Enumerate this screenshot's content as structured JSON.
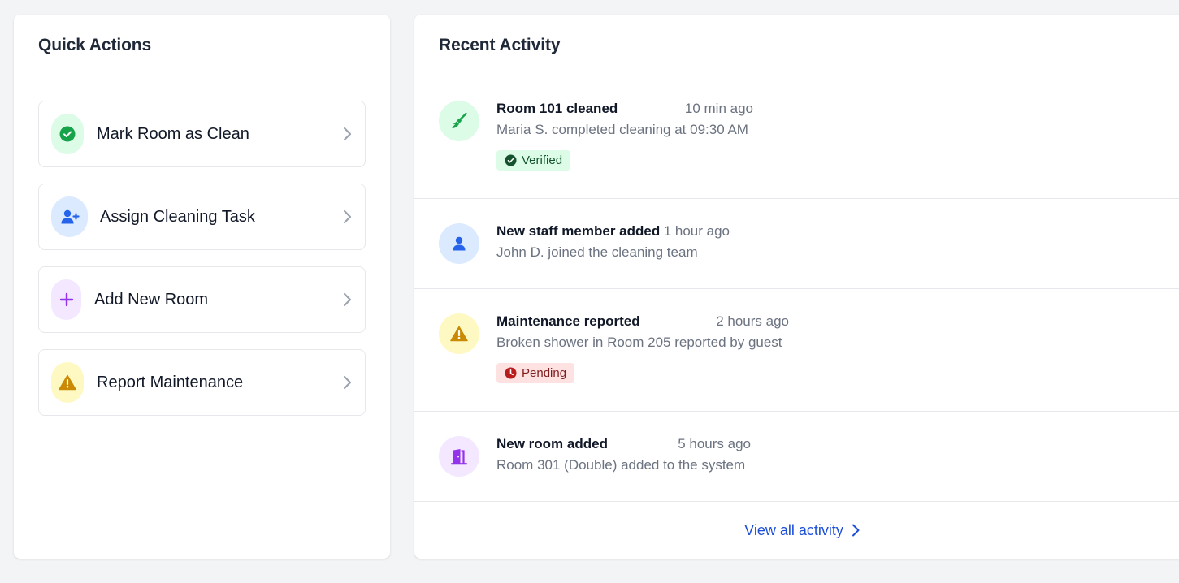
{
  "quick_actions": {
    "title": "Quick Actions",
    "items": [
      {
        "label": "Mark Room as Clean",
        "icon": "check-circle-icon",
        "color": "#16a34a"
      },
      {
        "label": "Assign Cleaning Task",
        "icon": "user-plus-icon",
        "color": "#2563eb"
      },
      {
        "label": "Add New Room",
        "icon": "plus-icon",
        "color": "#9333ea"
      },
      {
        "label": "Report Maintenance",
        "icon": "warning-icon",
        "color": "#ca8a04"
      }
    ]
  },
  "recent_activity": {
    "title": "Recent Activity",
    "items": [
      {
        "title": "Room 101 cleaned",
        "time": "10 min ago",
        "desc": "Maria S. completed cleaning at 09:30 AM",
        "badge": "Verified",
        "icon": "broom-icon"
      },
      {
        "title": "New staff member added",
        "time": "1 hour ago",
        "desc": "John D. joined the cleaning team",
        "icon": "user-icon"
      },
      {
        "title": "Maintenance reported",
        "time": "2 hours ago",
        "desc": "Broken shower in Room 205 reported by guest",
        "badge": "Pending",
        "icon": "warning-icon"
      },
      {
        "title": "New room added",
        "time": "5 hours ago",
        "desc": "Room 301 (Double) added to the system",
        "icon": "door-icon"
      }
    ],
    "view_all": "View all activity"
  },
  "colors": {
    "accent": "#1d4ed8",
    "success": "#16a34a",
    "warning": "#ca8a04",
    "danger": "#b91c1c",
    "purple": "#9333ea"
  }
}
